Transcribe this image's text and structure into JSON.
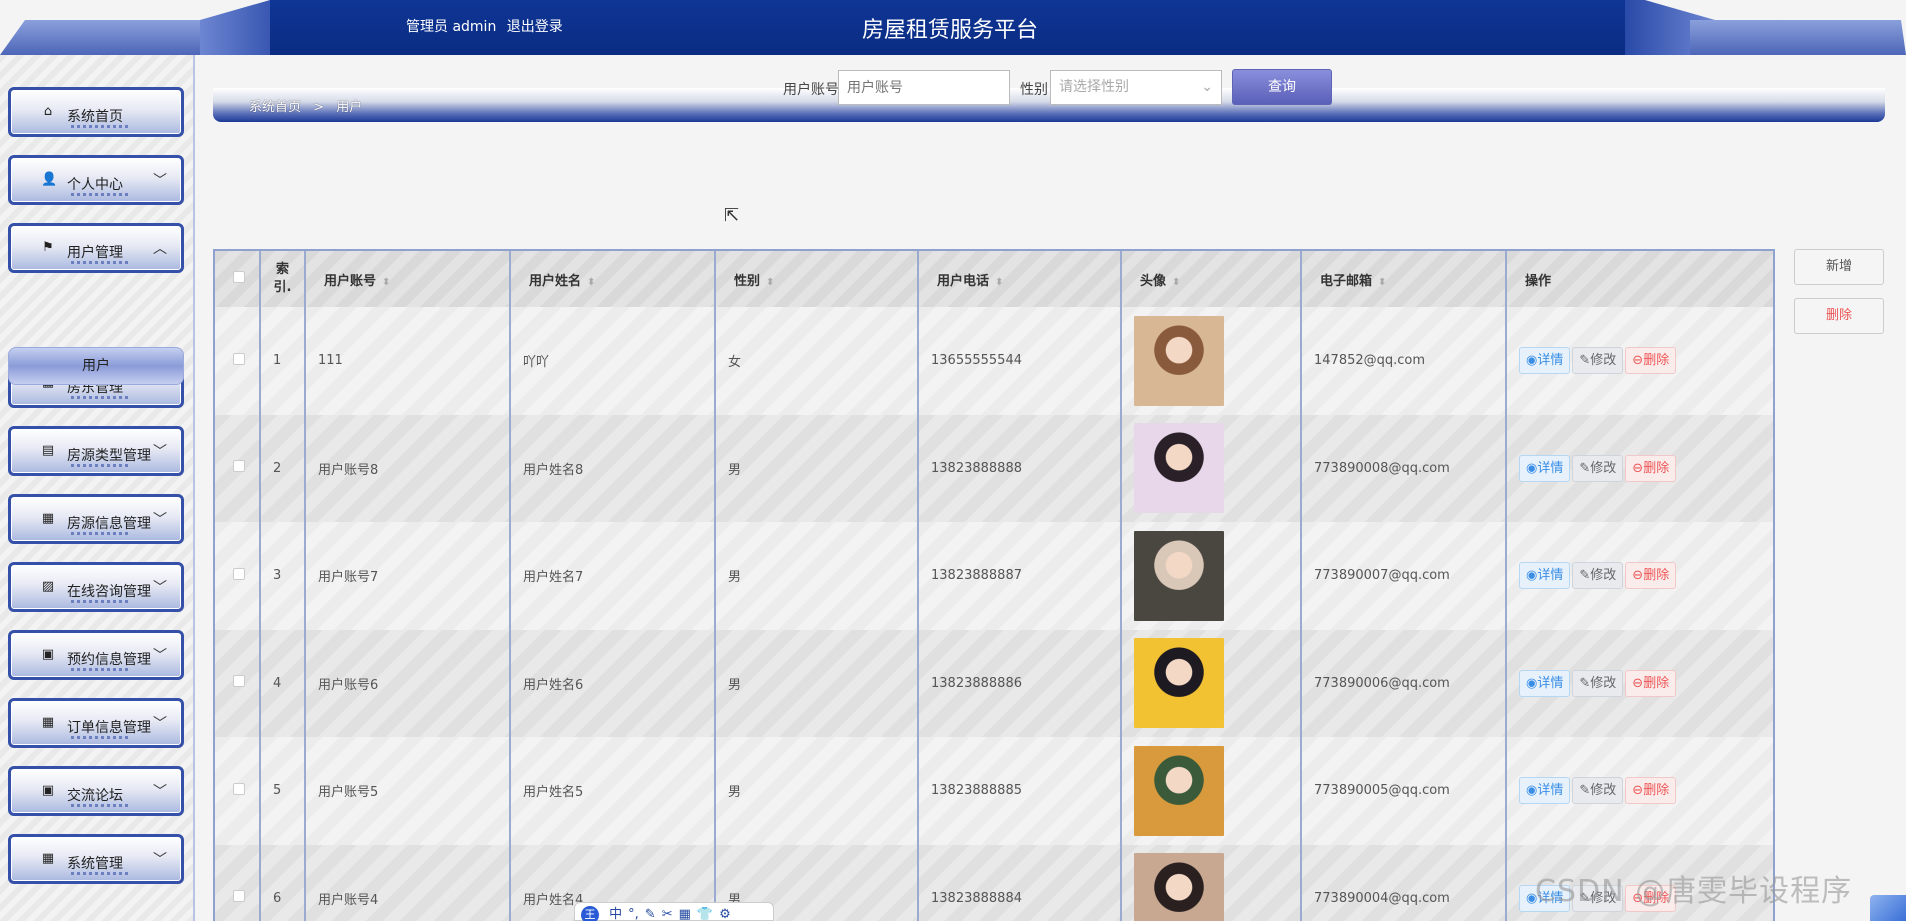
{
  "header": {
    "admin_label": "管理员 admin",
    "logout": "退出登录",
    "title": "房屋租赁服务平台"
  },
  "sidebar": {
    "items": [
      {
        "label": "系统首页",
        "icon": "home-icon",
        "glyph": "⌂",
        "chevron": ""
      },
      {
        "label": "个人中心",
        "icon": "user-icon",
        "glyph": "👤",
        "chevron": "﹀"
      },
      {
        "label": "用户管理",
        "icon": "flag-icon",
        "glyph": "⚑",
        "chevron": "︿"
      },
      {
        "label": "房东管理",
        "icon": "grid-icon",
        "glyph": "▦",
        "chevron": "﹀"
      },
      {
        "label": "房源类型管理",
        "icon": "chart-icon",
        "glyph": "▤",
        "chevron": "﹀"
      },
      {
        "label": "房源信息管理",
        "icon": "grid-icon",
        "glyph": "▦",
        "chevron": "﹀"
      },
      {
        "label": "在线咨询管理",
        "icon": "chat-icon",
        "glyph": "▨",
        "chevron": "﹀"
      },
      {
        "label": "预约信息管理",
        "icon": "clipboard-icon",
        "glyph": "▣",
        "chevron": "﹀"
      },
      {
        "label": "订单信息管理",
        "icon": "grid-icon",
        "glyph": "▦",
        "chevron": "﹀"
      },
      {
        "label": "交流论坛",
        "icon": "clipboard-icon",
        "glyph": "▣",
        "chevron": "﹀"
      },
      {
        "label": "系统管理",
        "icon": "grid-icon",
        "glyph": "▦",
        "chevron": "﹀"
      }
    ],
    "sub_item": "用户"
  },
  "breadcrumb": {
    "home": "系统首页",
    "sep": ">",
    "current": "用户"
  },
  "search": {
    "account_label": "用户账号",
    "account_placeholder": "用户账号",
    "gender_label": "性别",
    "gender_placeholder": "请选择性别",
    "query_button": "查询"
  },
  "actions": {
    "add": "新增",
    "delete": "删除"
  },
  "table": {
    "headers": {
      "index": "索\n引.",
      "account": "用户账号",
      "name": "用户姓名",
      "gender": "性别",
      "phone": "用户电话",
      "avatar": "头像",
      "email": "电子邮箱",
      "ops": "操作"
    },
    "ops": {
      "view": "详情",
      "edit": "修改",
      "del": "删除"
    },
    "rows": [
      {
        "index": "1",
        "account": "111",
        "name": "吖吖",
        "gender": "女",
        "phone": "13655555544",
        "email": "147852@qq.com",
        "avatar_colors": [
          "#d8b894",
          "#8a5a3c"
        ]
      },
      {
        "index": "2",
        "account": "用户账号8",
        "name": "用户姓名8",
        "gender": "男",
        "phone": "13823888888",
        "email": "773890008@qq.com",
        "avatar_colors": [
          "#e8d6ea",
          "#2a2028"
        ]
      },
      {
        "index": "3",
        "account": "用户账号7",
        "name": "用户姓名7",
        "gender": "男",
        "phone": "13823888887",
        "email": "773890007@qq.com",
        "avatar_colors": [
          "#4a4640",
          "#d9c8b8"
        ]
      },
      {
        "index": "4",
        "account": "用户账号6",
        "name": "用户姓名6",
        "gender": "男",
        "phone": "13823888886",
        "email": "773890006@qq.com",
        "avatar_colors": [
          "#f2c232",
          "#1e1a22"
        ]
      },
      {
        "index": "5",
        "account": "用户账号5",
        "name": "用户姓名5",
        "gender": "男",
        "phone": "13823888885",
        "email": "773890005@qq.com",
        "avatar_colors": [
          "#d89a3c",
          "#3a5a3a"
        ]
      },
      {
        "index": "6",
        "account": "用户账号4",
        "name": "用户姓名4",
        "gender": "男",
        "phone": "13823888884",
        "email": "773890004@qq.com",
        "avatar_colors": [
          "#c8a890",
          "#2a2020"
        ]
      }
    ]
  },
  "ime": {
    "logo": "王",
    "items": [
      "中",
      "°,",
      "✎",
      "✂",
      "▦",
      "👕",
      "⚙"
    ]
  },
  "watermark": "CSDN @唐雯毕设程序"
}
